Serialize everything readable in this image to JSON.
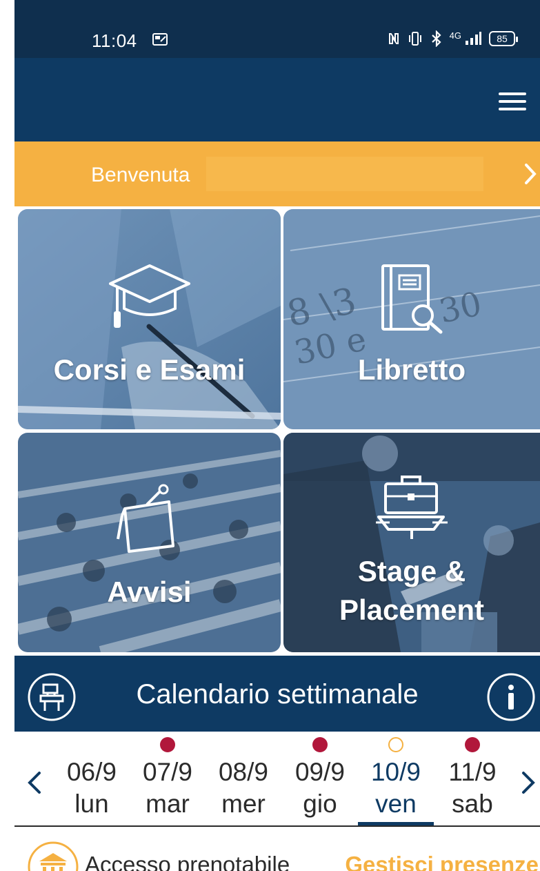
{
  "status_bar": {
    "time": "11:04",
    "network": "4G",
    "battery": "85"
  },
  "header": {
    "menu_icon": "hamburger-menu-icon"
  },
  "welcome": {
    "text": "Benvenuta"
  },
  "tiles": [
    {
      "label": "Corsi e Esami",
      "icon": "graduation-cap-icon"
    },
    {
      "label": "Libretto",
      "icon": "booklet-search-icon"
    },
    {
      "label": "Avvisi",
      "icon": "notice-icon"
    },
    {
      "label": "Stage & Placement",
      "label_line1": "Stage &",
      "label_line2": "Placement",
      "icon": "briefcase-icon"
    }
  ],
  "calendar": {
    "title": "Calendario settimanale",
    "left_icon": "classroom-desk-icon",
    "right_icon": "info-icon",
    "days": [
      {
        "num": "06/9",
        "name": "lun",
        "dot": "none"
      },
      {
        "num": "07/9",
        "name": "mar",
        "dot": "filled"
      },
      {
        "num": "08/9",
        "name": "mer",
        "dot": "none"
      },
      {
        "num": "09/9",
        "name": "gio",
        "dot": "filled"
      },
      {
        "num": "10/9",
        "name": "ven",
        "dot": "hollow",
        "selected": true
      },
      {
        "num": "11/9",
        "name": "sab",
        "dot": "filled"
      }
    ]
  },
  "bottom": {
    "text": "Accesso prenotabile",
    "link": "Gestisci presenze",
    "icon": "building-icon"
  },
  "colors": {
    "navy": "#0e3a63",
    "status_bar": "#0f2f4e",
    "accent_orange": "#f5b142",
    "dot_red": "#b1173b",
    "tile_tint": "#5b82ab"
  }
}
